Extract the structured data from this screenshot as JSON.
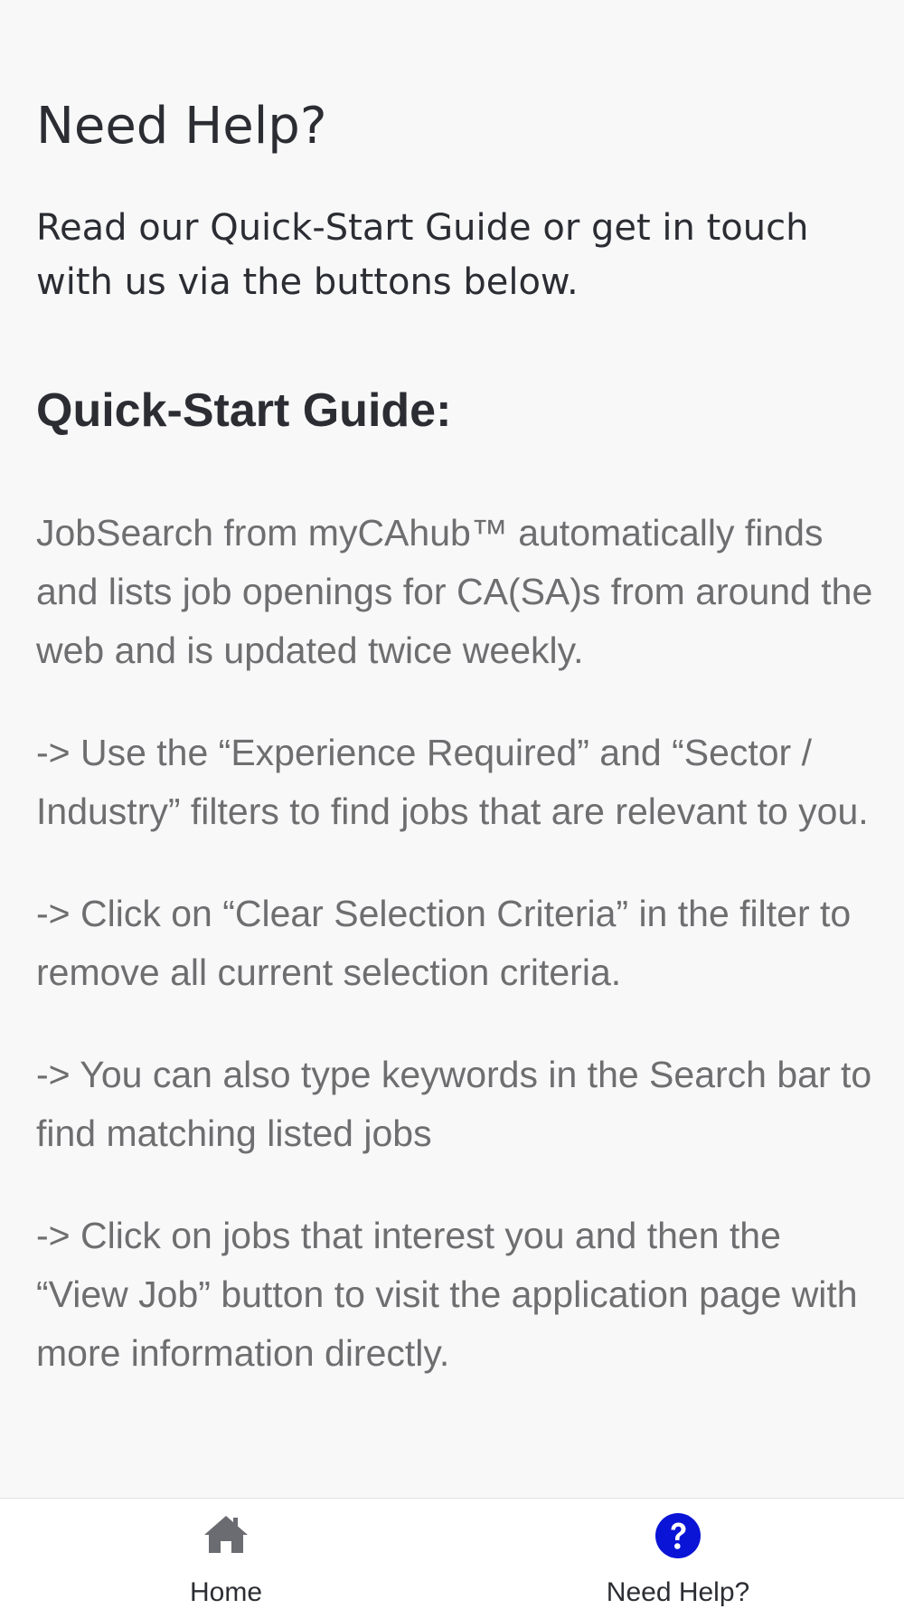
{
  "page": {
    "title": "Need Help?",
    "intro": "Read our Quick-Start Guide or get in touch with us via the buttons below."
  },
  "guide": {
    "heading": "Quick-Start Guide:",
    "items": [
      "JobSearch from myCAhub™ automatically finds and lists job openings for CA(SA)s from around the web and is updated twice weekly.",
      "-> Use the “Experience Required” and “Sector / Industry” filters to find jobs that are relevant to you.",
      "-> Click on “Clear Selection Criteria” in the filter to remove all current selection criteria.",
      "-> You can also type keywords in the Search bar to find matching listed jobs",
      "-> Click on jobs that interest you and then the “View Job” button to visit the application page with more information directly."
    ]
  },
  "bottom_nav": {
    "items": [
      {
        "label": "Home",
        "icon": "home-icon",
        "active": false
      },
      {
        "label": "Need Help?",
        "icon": "help-circle-icon",
        "active": true
      }
    ],
    "colors": {
      "home_icon": "#6b6b72",
      "help_icon": "#0a14d6"
    }
  }
}
